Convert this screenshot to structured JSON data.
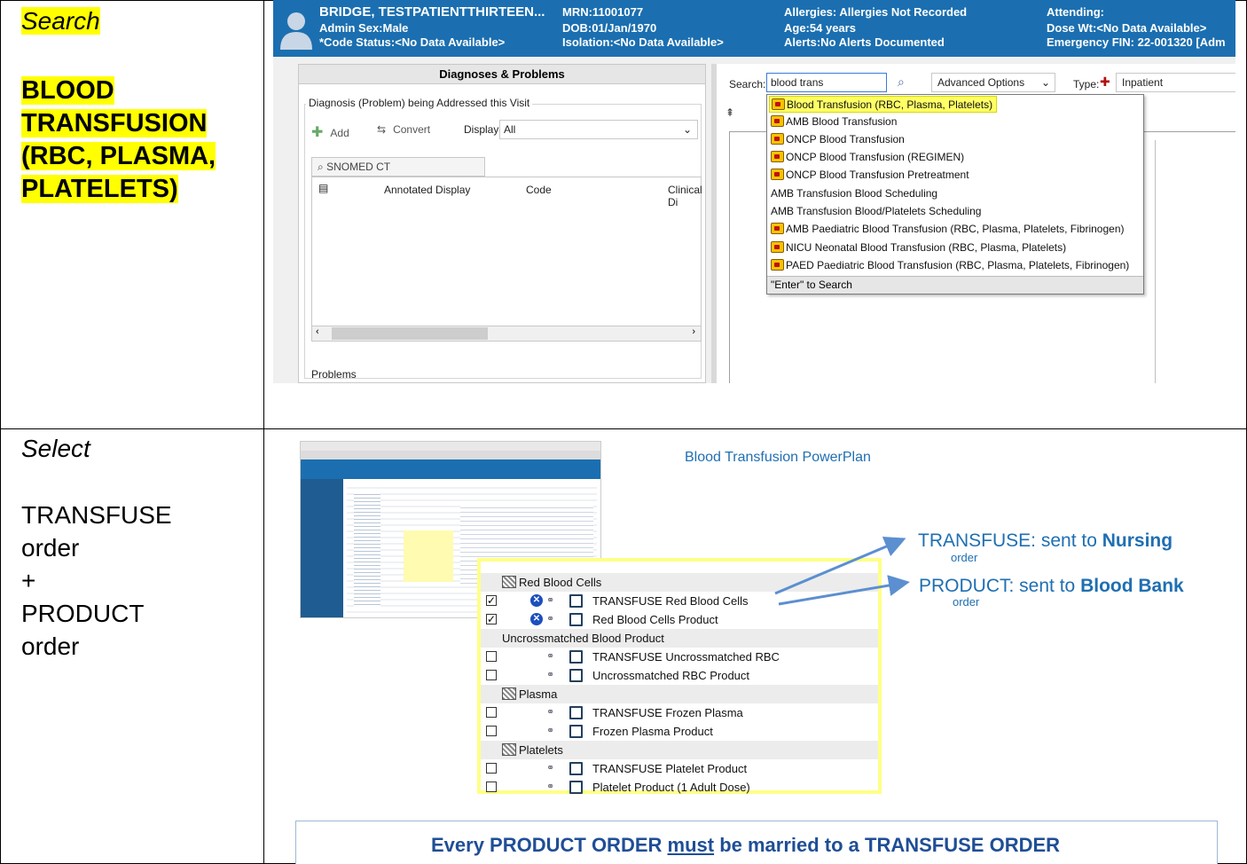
{
  "row1": {
    "step": "Search",
    "term": [
      "BLOOD",
      "TRANSFUSION",
      "(RBC, PLASMA,",
      "PLATELETS)"
    ]
  },
  "row2": {
    "step": "Select",
    "lines": [
      "TRANSFUSE",
      "order",
      "+",
      "PRODUCT",
      "order"
    ]
  },
  "banner": {
    "patient": "BRIDGE, TESTPATIENTTHIRTEEN...",
    "sex": "Admin Sex:Male",
    "code": "*Code Status:<No Data Available>",
    "mrn": "MRN:11001077",
    "dob": "DOB:01/Jan/1970",
    "isolation": "Isolation:<No Data Available>",
    "allergies": "Allergies: Allergies Not Recorded",
    "age": "Age:54 years",
    "alerts": "Alerts:No Alerts Documented",
    "attending": "Attending:",
    "dose": "Dose Wt:<No Data Available>",
    "fin": "Emergency FIN: 22-001320 [Adm"
  },
  "dx": {
    "title": "Diagnoses & Problems",
    "section": "Diagnosis (Problem) being Addressed this Visit",
    "add": "Add",
    "convert": "Convert",
    "display_label": "Display:",
    "display_value": "All",
    "snomed": "SNOMED CT",
    "col_annotated": "Annotated Display",
    "col_code": "Code",
    "col_clinical": "Clinical Di",
    "problems": "Problems"
  },
  "search": {
    "label": "Search:",
    "value": "blood trans",
    "advanced": "Advanced Options",
    "type_label": "Type:",
    "type_value": "Inpatient",
    "results": [
      {
        "text": "Blood Transfusion (RBC, Plasma, Platelets)",
        "icon": true,
        "selected": true
      },
      {
        "text": "AMB Blood Transfusion",
        "icon": true
      },
      {
        "text": "ONCP Blood Transfusion",
        "icon": true
      },
      {
        "text": "ONCP Blood Transfusion (REGIMEN)",
        "icon": true
      },
      {
        "text": "ONCP Blood Transfusion Pretreatment",
        "icon": true
      },
      {
        "text": "AMB Transfusion Blood Scheduling",
        "icon": false
      },
      {
        "text": "AMB Transfusion Blood/Platelets Scheduling",
        "icon": false
      },
      {
        "text": "AMB Paediatric Blood Transfusion (RBC, Plasma, Platelets, Fibrinogen)",
        "icon": true
      },
      {
        "text": "NICU Neonatal Blood Transfusion (RBC, Plasma, Platelets)",
        "icon": true
      },
      {
        "text": "PAED Paediatric Blood Transfusion (RBC, Plasma, Platelets, Fibrinogen)",
        "icon": true
      }
    ],
    "enter_hint": "\"Enter\" to Search"
  },
  "powerplan": {
    "title": "Blood Transfusion PowerPlan",
    "groups": [
      "Red Blood Cells",
      "Uncrossmatched Blood Product",
      "Plasma",
      "Platelets"
    ],
    "orders": [
      "TRANSFUSE Red Blood Cells",
      "Red Blood Cells Product",
      "TRANSFUSE Uncrossmatched RBC",
      "Uncrossmatched RBC Product",
      "TRANSFUSE Frozen Plasma",
      "Frozen Plasma Product",
      "TRANSFUSE Platelet Product",
      "Platelet Product (1 Adult Dose)"
    ],
    "call1_pre": "TRANSFUSE: sent to ",
    "call1_bold": "Nursing",
    "call2_pre": "PRODUCT: sent to ",
    "call2_bold": "Blood Bank",
    "order_word": "order",
    "footer_pre": "Every PRODUCT ORDER ",
    "footer_must": "must",
    "footer_post": " be married to a TRANSFUSE ORDER"
  }
}
